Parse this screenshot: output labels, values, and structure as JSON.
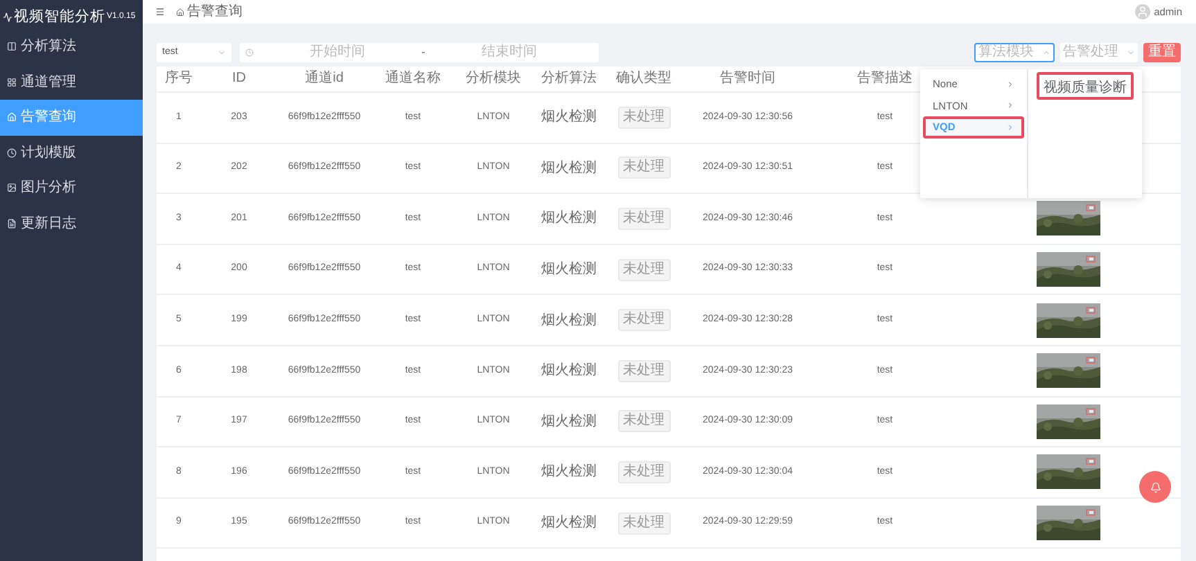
{
  "app": {
    "title": "视频智能分析",
    "version": "V1.0.15"
  },
  "sidebar": {
    "items": [
      {
        "label": "分析算法",
        "selected": false
      },
      {
        "label": "通道管理",
        "selected": false
      },
      {
        "label": "告警查询",
        "selected": true
      },
      {
        "label": "计划模版",
        "selected": false
      },
      {
        "label": "图片分析",
        "selected": false
      },
      {
        "label": "更新日志",
        "selected": false
      }
    ]
  },
  "breadcrumb": "告警查询",
  "user": "admin",
  "filters": {
    "channel": "test",
    "start_placeholder": "开始时间",
    "separator": "-",
    "end_placeholder": "结束时间",
    "module": {
      "placeholder": "算法模块",
      "expanded": true
    },
    "handling": {
      "placeholder": "告警处理"
    },
    "reset": "重置"
  },
  "cascader": {
    "options": [
      {
        "label": "None",
        "selected": false,
        "highlighted": false
      },
      {
        "label": "LNTON",
        "selected": false,
        "highlighted": false
      },
      {
        "label": "VQD",
        "selected": true,
        "highlighted": true
      }
    ],
    "children": [
      {
        "label": "视频质量诊断",
        "highlighted": true
      }
    ]
  },
  "table": {
    "columns": [
      "序号",
      "ID",
      "通道id",
      "通道名称",
      "分析模块",
      "分析算法",
      "确认类型",
      "告警时间",
      "告警描述"
    ],
    "rows": [
      {
        "index": "1",
        "id": "203",
        "channel_id": "66f9fb12e2fff550",
        "name": "test",
        "module": "LNTON",
        "algorithm": "烟火检测",
        "status": "未处理",
        "time": "2024-09-30 12:30:56",
        "description": "test",
        "picture": false
      },
      {
        "index": "2",
        "id": "202",
        "channel_id": "66f9fb12e2fff550",
        "name": "test",
        "module": "LNTON",
        "algorithm": "烟火检测",
        "status": "未处理",
        "time": "2024-09-30 12:30:51",
        "description": "test",
        "picture": false
      },
      {
        "index": "3",
        "id": "201",
        "channel_id": "66f9fb12e2fff550",
        "name": "test",
        "module": "LNTON",
        "algorithm": "烟火检测",
        "status": "未处理",
        "time": "2024-09-30 12:30:46",
        "description": "test",
        "picture": true
      },
      {
        "index": "4",
        "id": "200",
        "channel_id": "66f9fb12e2fff550",
        "name": "test",
        "module": "LNTON",
        "algorithm": "烟火检测",
        "status": "未处理",
        "time": "2024-09-30 12:30:33",
        "description": "test",
        "picture": true
      },
      {
        "index": "5",
        "id": "199",
        "channel_id": "66f9fb12e2fff550",
        "name": "test",
        "module": "LNTON",
        "algorithm": "烟火检测",
        "status": "未处理",
        "time": "2024-09-30 12:30:28",
        "description": "test",
        "picture": true
      },
      {
        "index": "6",
        "id": "198",
        "channel_id": "66f9fb12e2fff550",
        "name": "test",
        "module": "LNTON",
        "algorithm": "烟火检测",
        "status": "未处理",
        "time": "2024-09-30 12:30:23",
        "description": "test",
        "picture": true
      },
      {
        "index": "7",
        "id": "197",
        "channel_id": "66f9fb12e2fff550",
        "name": "test",
        "module": "LNTON",
        "algorithm": "烟火检测",
        "status": "未处理",
        "time": "2024-09-30 12:30:09",
        "description": "test",
        "picture": true
      },
      {
        "index": "8",
        "id": "196",
        "channel_id": "66f9fb12e2fff550",
        "name": "test",
        "module": "LNTON",
        "algorithm": "烟火检测",
        "status": "未处理",
        "time": "2024-09-30 12:30:04",
        "description": "test",
        "picture": true
      },
      {
        "index": "9",
        "id": "195",
        "channel_id": "66f9fb12e2fff550",
        "name": "test",
        "module": "LNTON",
        "algorithm": "烟火检测",
        "status": "未处理",
        "time": "2024-09-30 12:29:59",
        "description": "test",
        "picture": true
      }
    ]
  }
}
